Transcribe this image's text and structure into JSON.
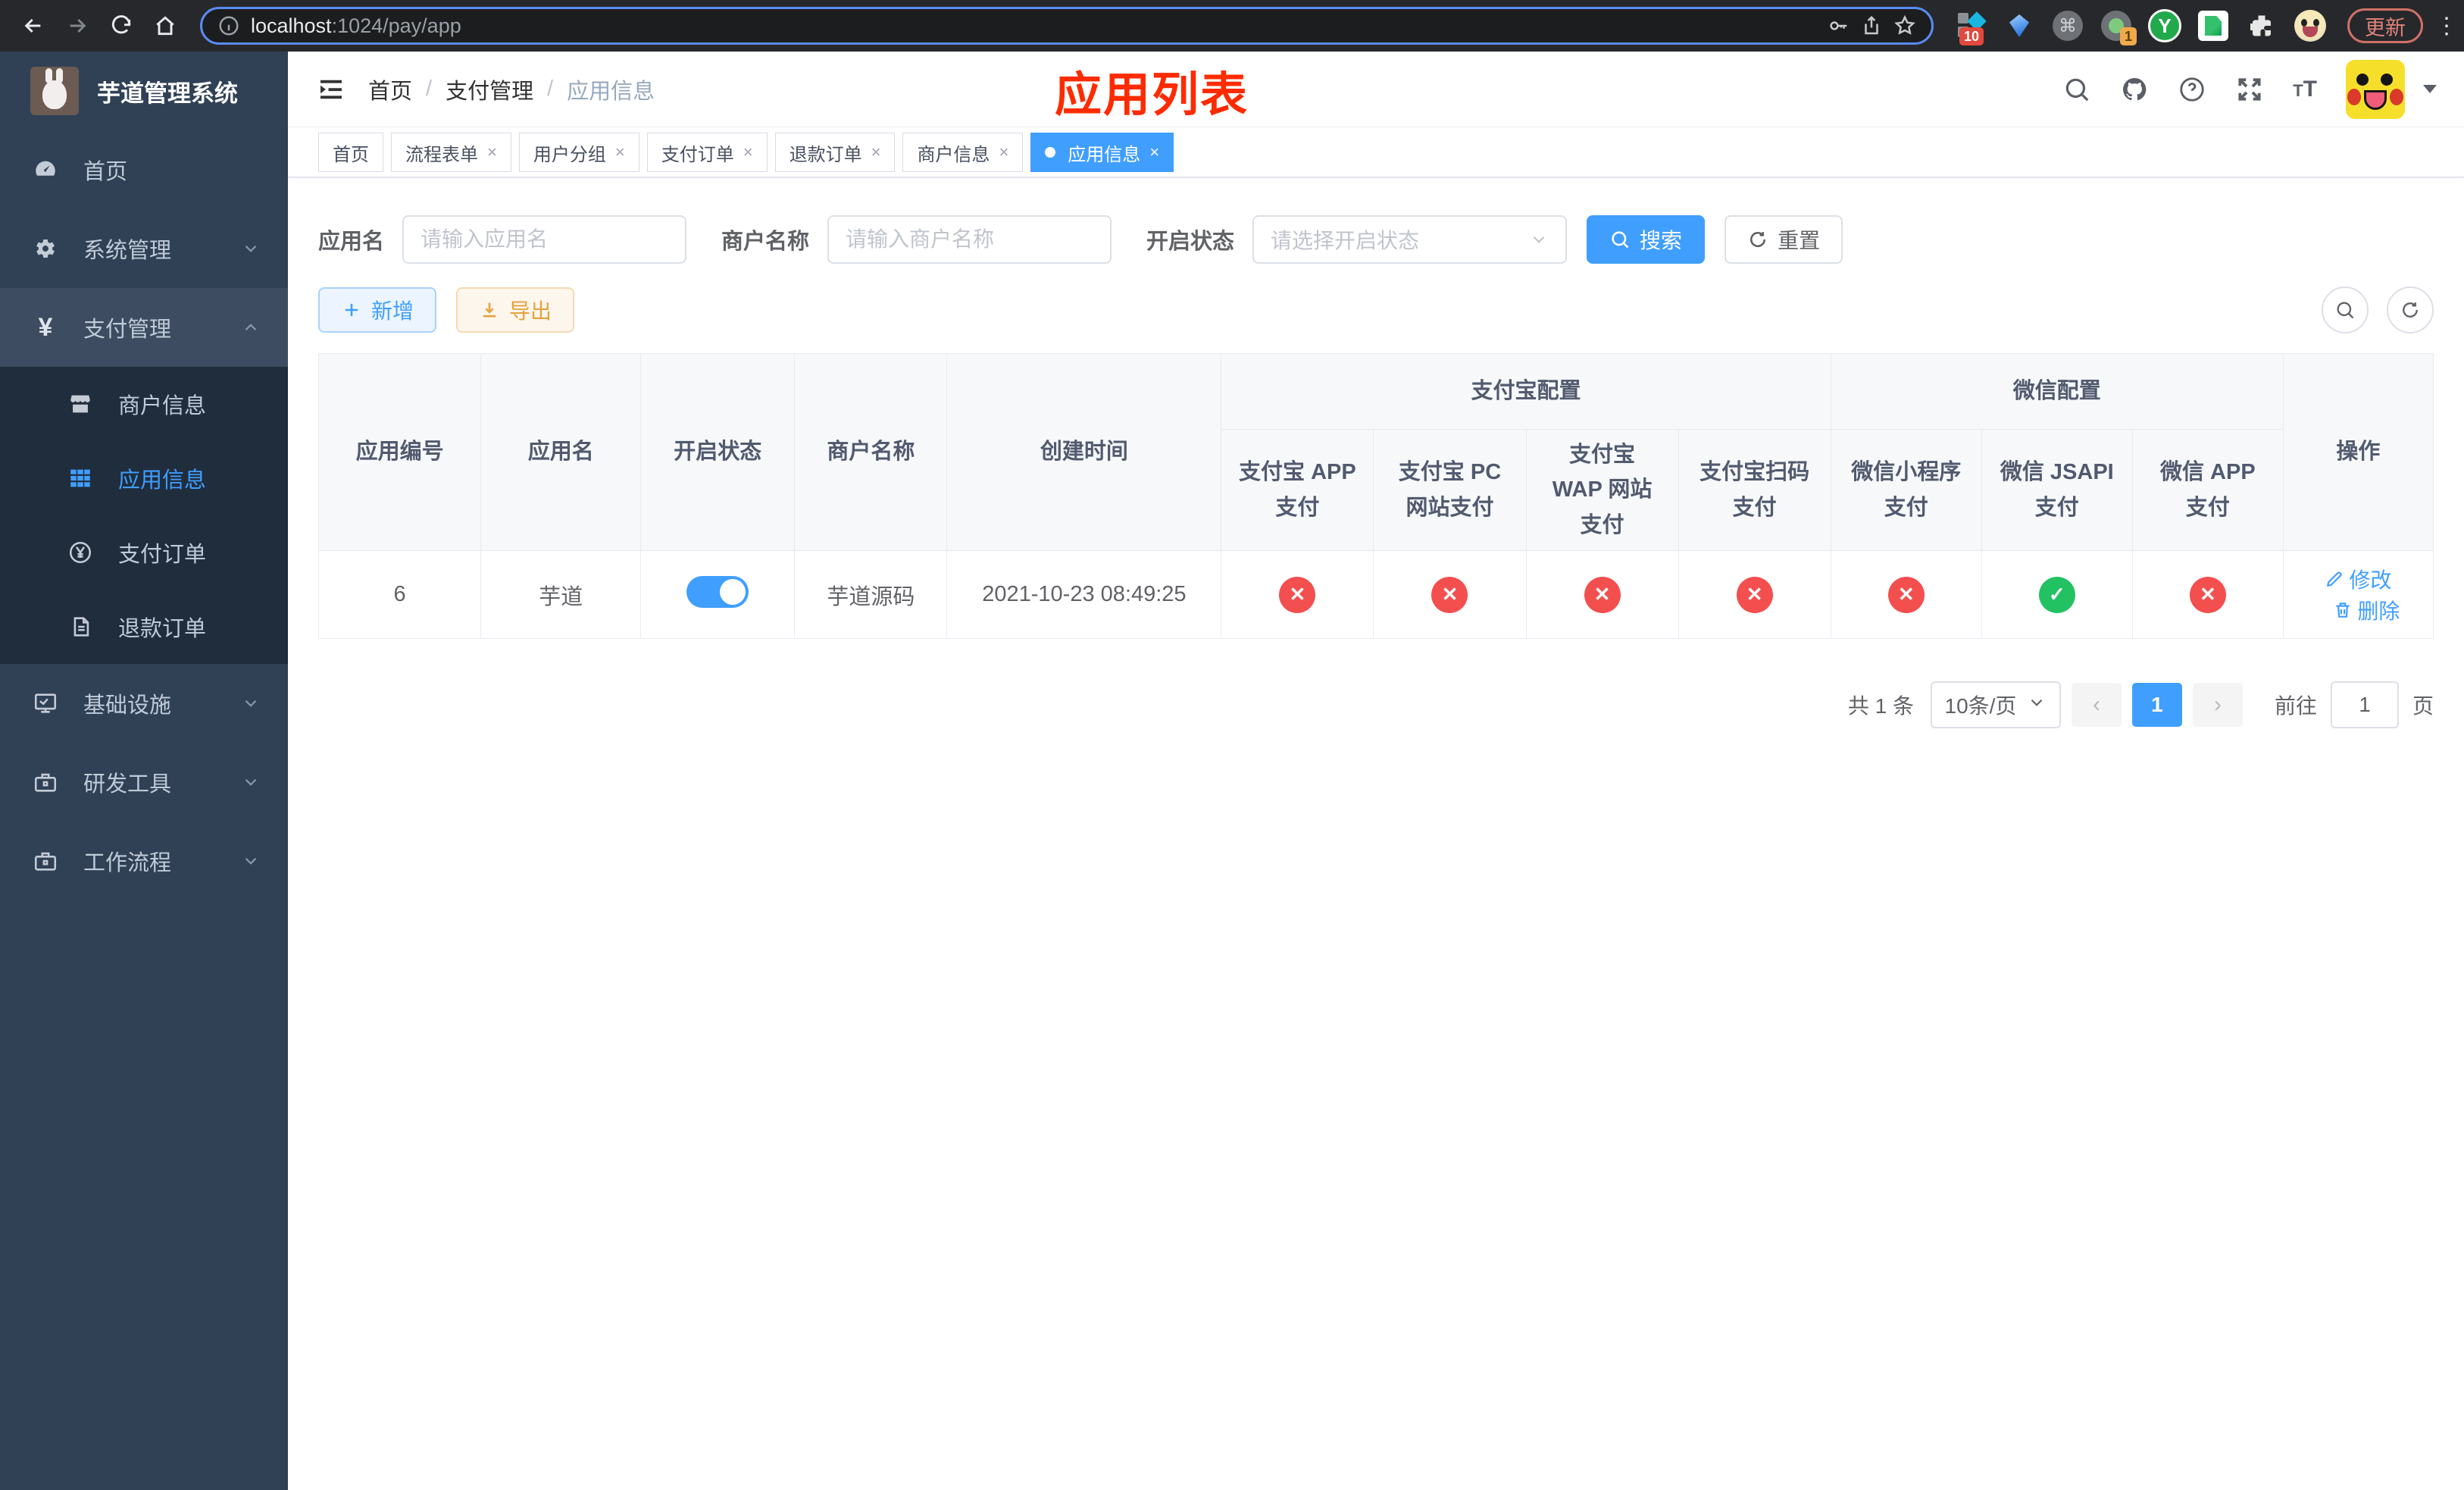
{
  "browser": {
    "url_host": "localhost",
    "url_rest": ":1024/pay/app",
    "ext_badge_1": "10",
    "ext_badge_2": "1",
    "ext_y_label": "Y",
    "command_glyph": "⌘",
    "update_label": "更新",
    "kebab_glyph": "⋮"
  },
  "sidebar": {
    "logo_title": "芋道管理系统",
    "menu": [
      {
        "label": "首页"
      },
      {
        "label": "系统管理"
      },
      {
        "label": "支付管理"
      },
      {
        "label": "商户信息"
      },
      {
        "label": "应用信息"
      },
      {
        "label": "支付订单"
      },
      {
        "label": "退款订单"
      },
      {
        "label": "基础设施"
      },
      {
        "label": "研发工具"
      },
      {
        "label": "工作流程"
      }
    ]
  },
  "breadcrumb": [
    "首页",
    "支付管理",
    "应用信息"
  ],
  "annotation": "应用列表",
  "tabs": [
    {
      "label": "首页",
      "closable": false,
      "active": false
    },
    {
      "label": "流程表单",
      "closable": true,
      "active": false
    },
    {
      "label": "用户分组",
      "closable": true,
      "active": false
    },
    {
      "label": "支付订单",
      "closable": true,
      "active": false
    },
    {
      "label": "退款订单",
      "closable": true,
      "active": false
    },
    {
      "label": "商户信息",
      "closable": true,
      "active": false
    },
    {
      "label": "应用信息",
      "closable": true,
      "active": true
    }
  ],
  "filters": {
    "app_name_label": "应用名",
    "app_name_placeholder": "请输入应用名",
    "merchant_label": "商户名称",
    "merchant_placeholder": "请输入商户名称",
    "status_label": "开启状态",
    "status_placeholder": "请选择开启状态",
    "search_label": "搜索",
    "reset_label": "重置"
  },
  "toolbar": {
    "add_label": "新增",
    "export_label": "导出"
  },
  "table": {
    "headers": {
      "app_id": "应用编号",
      "app_name": "应用名",
      "status": "开启状态",
      "merchant": "商户名称",
      "create_time": "创建时间",
      "alipay_group": "支付宝配置",
      "wechat_group": "微信配置",
      "actions": "操作",
      "alipay_cols": [
        "支付宝 APP 支付",
        "支付宝 PC 网站支付",
        "支付宝 WAP 网站支付",
        "支付宝扫码支付"
      ],
      "wechat_cols": [
        "微信小程序支付",
        "微信 JSAPI 支付",
        "微信 APP 支付"
      ]
    },
    "rows": [
      {
        "app_id": "6",
        "app_name": "芋道",
        "status_on": true,
        "merchant": "芋道源码",
        "create_time": "2021-10-23 08:49:25",
        "configs": [
          "error",
          "error",
          "error",
          "error",
          "error",
          "success",
          "error"
        ],
        "edit_label": "修改",
        "delete_label": "删除"
      }
    ]
  },
  "pagination": {
    "total": "共 1 条",
    "page_size": "10条/页",
    "prev": "‹",
    "current": "1",
    "next": "›",
    "goto_label": "前往",
    "goto_value": "1",
    "page_unit": "页"
  },
  "colors": {
    "accent": "#409eff",
    "success": "#22c262",
    "danger": "#f34f4f",
    "sidebar": "#304156"
  }
}
